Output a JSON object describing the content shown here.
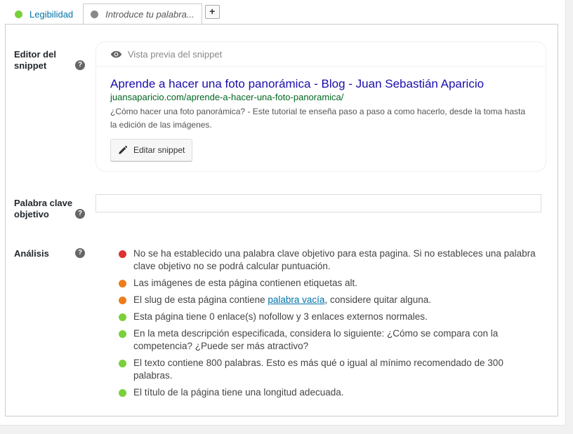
{
  "tabs": {
    "readability": "Legibilidad",
    "keyword": "Introduce tu palabra...",
    "add": "+"
  },
  "snippet_editor": {
    "label": "Editor del snippet",
    "help": "?",
    "preview_header": "Vista previa del snippet",
    "title": "Aprende a hacer una foto panorámica - Blog - Juan Sebastián Aparicio",
    "url": "juansaparicio.com/aprende-a-hacer-una-foto-panoramica/",
    "description": "¿Cómo hacer una foto panorámica? - Este tutorial te enseña paso a paso a como hacerlo, desde la toma hasta la edición de las imágenes.",
    "edit_button": "Editar snippet"
  },
  "focus_keyword": {
    "label": "Palabra clave objetivo",
    "help": "?",
    "value": ""
  },
  "analysis": {
    "label": "Análisis",
    "help": "?",
    "items": [
      {
        "status": "red",
        "text": "No se ha establecido una palabra clave objetivo para esta pagina. Si no estableces una palabra clave objetivo no se podrá calcular puntuación."
      },
      {
        "status": "orange",
        "text": "Las imágenes de esta página contienen etiquetas alt."
      },
      {
        "status": "orange",
        "text_before": "El slug de esta página contiene ",
        "link": "palabra vacía",
        "text_after": ", considere quitar alguna."
      },
      {
        "status": "green",
        "text": "Esta página tiene 0 enlace(s) nofollow y 3 enlaces externos normales."
      },
      {
        "status": "green",
        "text": "En la meta descripción especificada, considera lo siguiente: ¿Cómo se compara con la competencia? ¿Puede ser más atractivo?"
      },
      {
        "status": "green",
        "text": "El texto contiene 800 palabras. Esto es más qué o igual al mínimo recomendado de 300 palabras."
      },
      {
        "status": "green",
        "text": "El título de la página tiene una longitud adecuada."
      }
    ]
  },
  "colors": {
    "red": "#dc3232",
    "orange": "#ee7c1b",
    "green": "#7ad03a",
    "link": "#0073aa",
    "serp_title": "#1a0dab",
    "serp_url": "#006621"
  }
}
